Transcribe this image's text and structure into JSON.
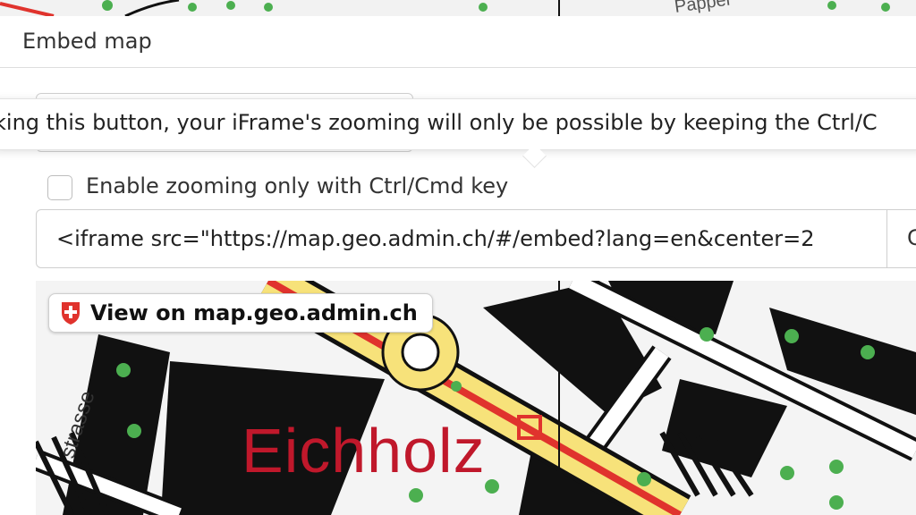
{
  "modal": {
    "title": "Embed map"
  },
  "tooltip": {
    "text": "king this button, your iFrame's zooming will only be possible by keeping the Ctrl/C"
  },
  "zoom_option": {
    "label": "Enable zooming only with Ctrl/Cmd key",
    "checked": false
  },
  "embed_code": {
    "value": "<iframe src=\"https://map.geo.admin.ch/#/embed?lang=en&center=2",
    "copy_label": "C"
  },
  "preview": {
    "view_on_label": "View on map.geo.admin.ch",
    "place_label": "Eichholz",
    "street_label": "strasse",
    "icon": "swiss-cross-shield-icon"
  },
  "background_map": {
    "partial_label": "Pappel"
  },
  "colors": {
    "accent_red": "#c0182b",
    "road_yellow": "#f7e27a",
    "road_red": "#e0332d",
    "tree_green": "#4caf50"
  }
}
